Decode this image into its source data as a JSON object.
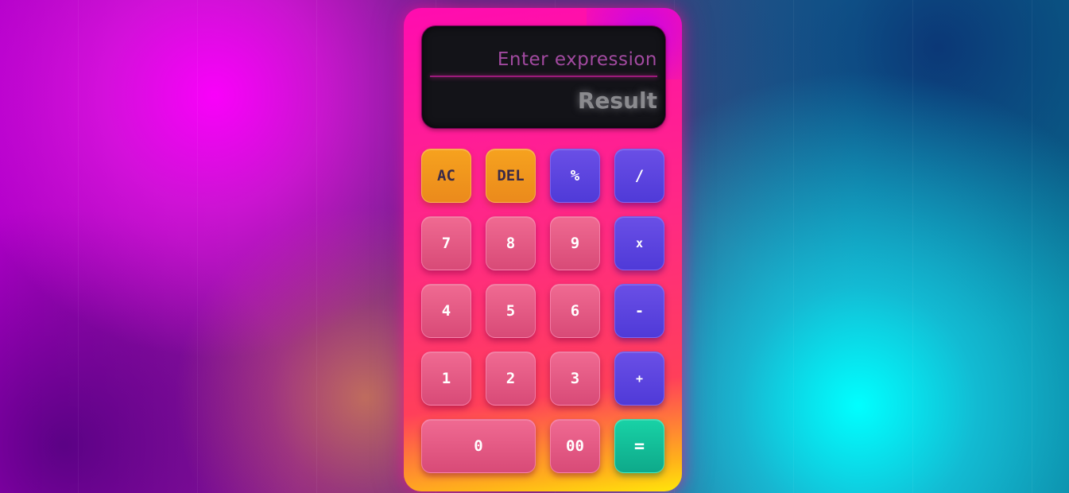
{
  "display": {
    "expression_placeholder": "Enter expression",
    "result_placeholder": "Result"
  },
  "keys": {
    "ac": "AC",
    "del": "DEL",
    "percent": "%",
    "divide": "/",
    "seven": "7",
    "eight": "8",
    "nine": "9",
    "multiply": "x",
    "four": "4",
    "five": "5",
    "six": "6",
    "subtract": "-",
    "one": "1",
    "two": "2",
    "three": "3",
    "add": "+",
    "zero": "0",
    "double_zero": "00",
    "equals": "="
  },
  "colors": {
    "number_key": "#e05a84",
    "operator_key": "#5a44de",
    "function_key": "#f0961e",
    "equals_key": "#12bf98",
    "display_bg": "#131318"
  }
}
